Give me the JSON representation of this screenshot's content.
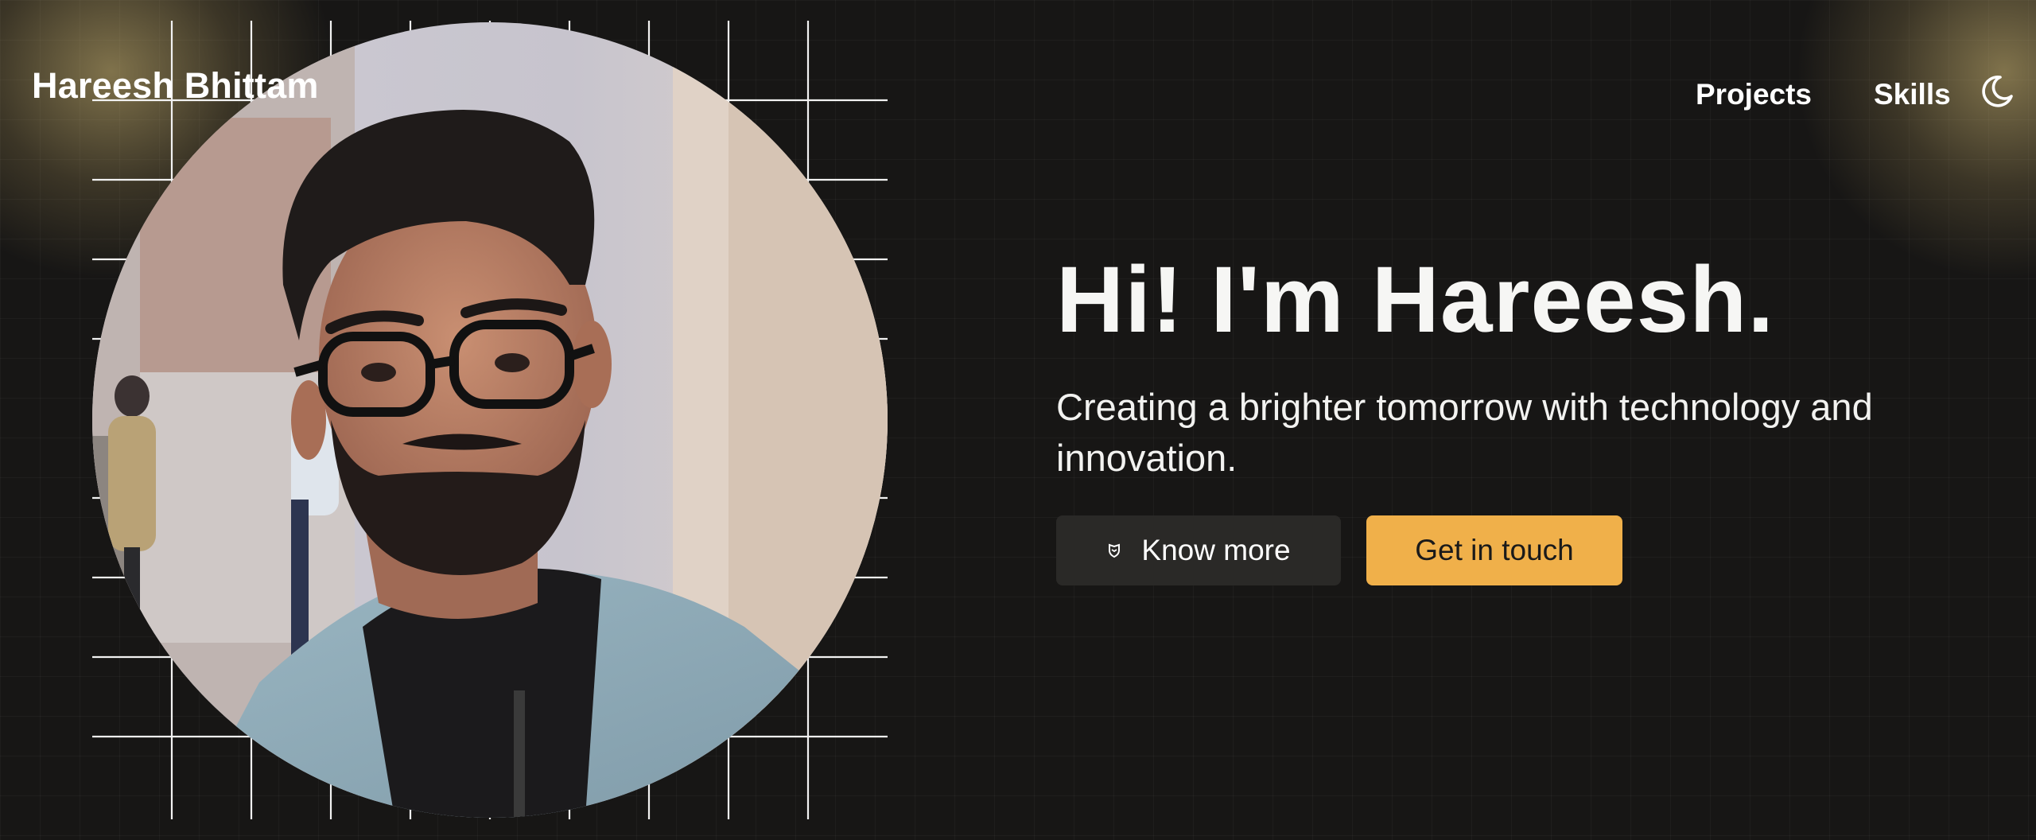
{
  "header": {
    "brand": "Hareesh Bhittam",
    "nav": [
      {
        "label": "Projects"
      },
      {
        "label": "Skills"
      }
    ],
    "theme_toggle_icon": "moon-icon"
  },
  "hero": {
    "title": "Hi! I'm Hareesh.",
    "subtitle": "Creating a brighter tomorrow with technology and innovation.",
    "buttons": {
      "know_more": {
        "label": "Know more",
        "icon": "shield-icon"
      },
      "get_in_touch": {
        "label": "Get in touch"
      }
    },
    "portrait_alt": "portrait-photo"
  },
  "colors": {
    "background": "#171615",
    "accent": "#f0b04a",
    "secondary_button": "#2a2927",
    "glow": "#d6be78"
  }
}
